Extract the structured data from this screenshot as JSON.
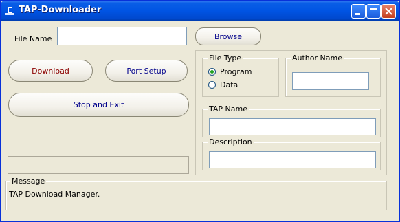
{
  "window": {
    "title": "TAP-Downloader",
    "icons": [
      "app-icon",
      "minimize-icon",
      "maximize-icon",
      "close-icon"
    ]
  },
  "form": {
    "file_name_label": "File Name",
    "file_name_value": "",
    "browse_label": "Browse",
    "download_label": "Download",
    "port_setup_label": "Port Setup",
    "stop_exit_label": "Stop and Exit",
    "progress": ""
  },
  "file_type": {
    "legend": "File Type",
    "options": [
      {
        "label": "Program",
        "selected": true
      },
      {
        "label": "Data",
        "selected": false
      }
    ]
  },
  "author": {
    "legend": "Author Name",
    "value": ""
  },
  "tap_name": {
    "legend": "TAP Name",
    "value": ""
  },
  "description": {
    "legend": "Description",
    "value": ""
  },
  "message": {
    "legend": "Message",
    "text": "TAP Download Manager."
  },
  "colors": {
    "title_bar": "#0054e3",
    "download_text": "#8b0000",
    "button_text": "#00008b",
    "face": "#ece9d8"
  }
}
